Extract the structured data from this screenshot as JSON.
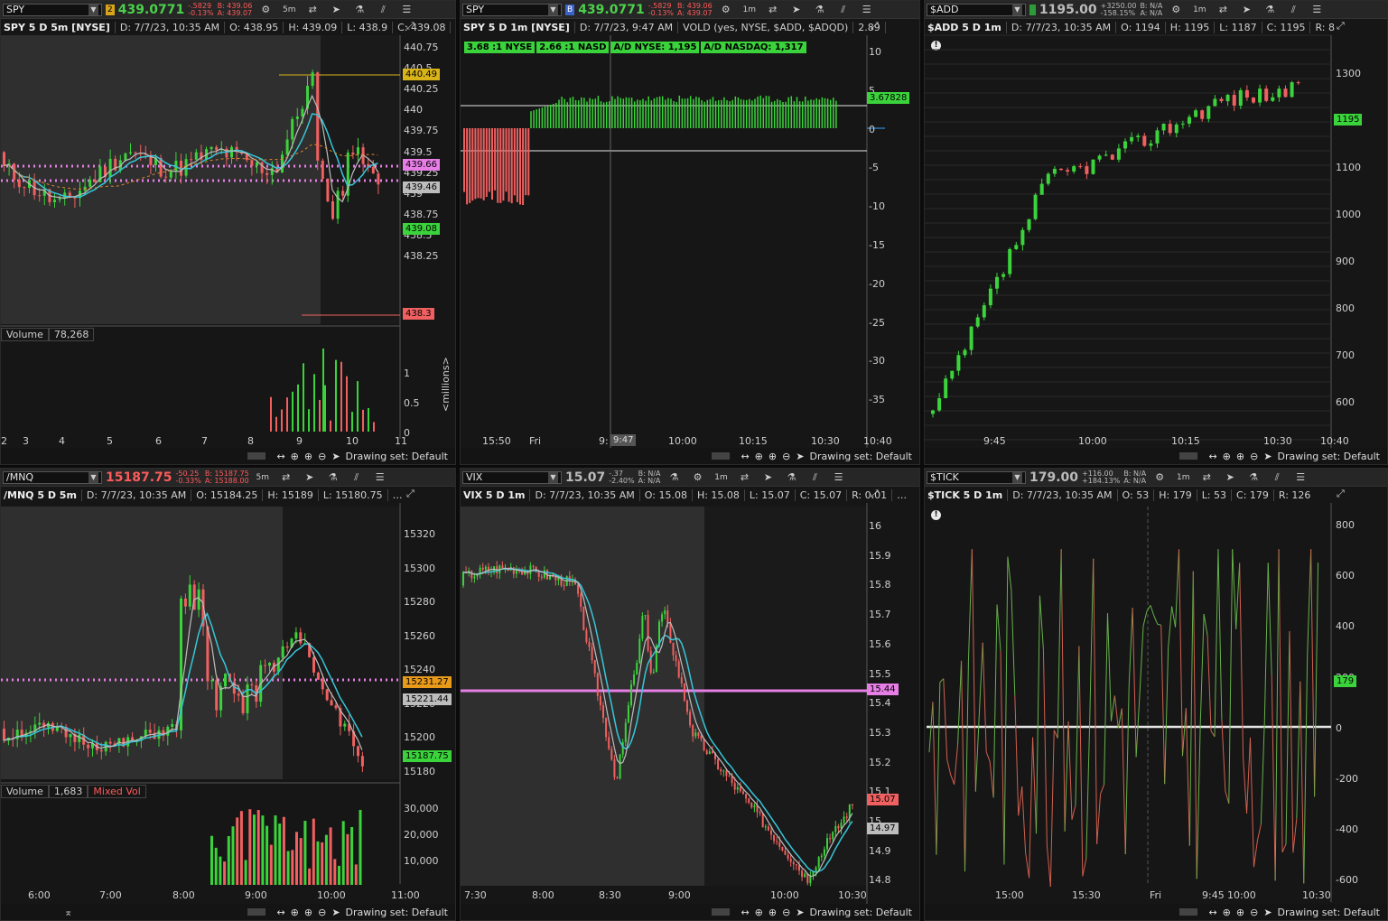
{
  "panels": {
    "spy5": {
      "symbol": "SPY",
      "badge": "2",
      "price": "439.0771",
      "chg1": "-.5829",
      "chg2": "-0.13%",
      "bid": "B: 439.06",
      "ask": "A: 439.07",
      "tf": "5m",
      "title": "SPY 5 D 5m [NYSE]",
      "date": "D: 7/7/23, 10:35 AM",
      "open": "O: 438.95",
      "high": "H: 439.09",
      "low": "L: 438.9",
      "close": "C: 439.08",
      "yticks": [
        "440.75",
        "440.5",
        "440.25",
        "440",
        "439.75",
        "439.5",
        "439.25",
        "439",
        "438.75",
        "438.5",
        "438.25"
      ],
      "labels": {
        "hi": "440.49",
        "pink": "439.66",
        "gray": "439.46",
        "last": "439.08",
        "lo": "438.3"
      },
      "vol_label": "Volume",
      "vol_val": "78,268",
      "vol_ticks": [
        "1",
        "0.5",
        "0"
      ],
      "vol_unit": "<millions>",
      "xticks": [
        "2",
        "3",
        "4",
        "5",
        "6",
        "7",
        "8",
        "9",
        "10",
        "11"
      ],
      "drawing": "Drawing set: Default"
    },
    "vold": {
      "symbol": "SPY",
      "badge": "B",
      "price": "439.0771",
      "chg1": "-.5829",
      "chg2": "-0.13%",
      "bid": "B: 439.06",
      "ask": "A: 439.07",
      "tf": "1m",
      "title": "SPY 5 D 1m [NYSE]",
      "date": "D: 7/7/23, 9:47 AM",
      "study": "VOLD (yes, NYSE, $ADD, $ADQD)",
      "study_val": "2.89",
      "chips": [
        "3.68 :1 NYSE",
        "2.66 :1 NASD",
        "A/D NYSE: 1,195",
        "A/D NASDAQ: 1,317"
      ],
      "yticks": [
        "10",
        "5",
        "0",
        "-5",
        "-10",
        "-15",
        "-20",
        "-25",
        "-30",
        "-35"
      ],
      "last": "3.67828",
      "xticks": [
        "15:50",
        "Fri",
        "9:",
        "10:00",
        "10:15",
        "10:30",
        "10:40"
      ],
      "cursor": "9:47",
      "drawing": "Drawing set: Default"
    },
    "add": {
      "symbol": "$ADD",
      "price": "1195.00",
      "chg1": "+3250.00",
      "chg2": "-158.15%",
      "bid": "B: N/A",
      "ask": "A: N/A",
      "tf": "1m",
      "title": "$ADD 5 D 1m",
      "date": "D: 7/7/23, 10:35 AM",
      "open": "O: 1194",
      "high": "H: 1195",
      "low": "L: 1187",
      "close": "C: 1195",
      "range": "R: 8",
      "yticks": [
        "1300",
        "1200",
        "1100",
        "1000",
        "900",
        "800",
        "700",
        "600"
      ],
      "last": "1195",
      "xticks": [
        "9:45",
        "10:00",
        "10:15",
        "10:30",
        "10:40"
      ],
      "drawing": "Drawing set: Default"
    },
    "mnq": {
      "symbol": "/MNQ",
      "price": "15187.75",
      "chg1": "-50.25",
      "chg2": "-0.33%",
      "bid": "B: 15187.75",
      "ask": "A: 15188.00",
      "tf": "5m",
      "title": "/MNQ 5 D 5m",
      "date": "D: 7/7/23, 10:35 AM",
      "open": "O: 15184.25",
      "high": "H: 15189",
      "low": "L: 15180.75",
      "yticks": [
        "15320",
        "15300",
        "15280",
        "15260",
        "15240",
        "15220",
        "15200",
        "15180"
      ],
      "labels": {
        "orange": "15231.27",
        "gray": "15221.44",
        "last": "15187.75"
      },
      "vol_label": "Volume",
      "vol_val": "1,683",
      "vol_mixed": "Mixed Vol",
      "vol_ticks": [
        "30,000",
        "20,000",
        "10,000"
      ],
      "xticks": [
        "6:00",
        "7:00",
        "8:00",
        "9:00",
        "10:00",
        "11:00"
      ],
      "drawing": "Drawing set: Default"
    },
    "vix": {
      "symbol": "VIX",
      "price": "15.07",
      "chg1": "-.37",
      "chg2": "-2.40%",
      "bid": "B: N/A",
      "ask": "A: N/A",
      "tf": "1m",
      "title": "VIX 5 D 1m",
      "date": "D: 7/7/23, 10:35 AM",
      "open": "O: 15.08",
      "high": "H: 15.08",
      "low": "L: 15.07",
      "close": "C: 15.07",
      "range": "R: 0.01",
      "yticks": [
        "16",
        "15.9",
        "15.8",
        "15.7",
        "15.6",
        "15.5",
        "15.4",
        "15.3",
        "15.2",
        "15.1",
        "15",
        "14.9",
        "14.8"
      ],
      "labels": {
        "pink": "15.44",
        "last": "15.07",
        "gray": "14.97"
      },
      "xticks": [
        "7:30",
        "8:00",
        "8:30",
        "9:00",
        "10:00",
        "10:30"
      ],
      "drawing": "Drawing set: Default"
    },
    "tick": {
      "symbol": "$TICK",
      "price": "179.00",
      "chg1": "+116.00",
      "chg2": "+184.13%",
      "bid": "B: N/A",
      "ask": "A: N/A",
      "tf": "1m",
      "title": "$TICK 5 D 1m",
      "date": "D: 7/7/23, 10:35 AM",
      "open": "O: 53",
      "high": "H: 179",
      "low": "L: 53",
      "close": "C: 179",
      "range": "R: 126",
      "yticks": [
        "800",
        "600",
        "400",
        "200",
        "0",
        "-200",
        "-400",
        "-600"
      ],
      "last": "179",
      "xticks": [
        "15:00",
        "15:30",
        "Fri",
        "9:45",
        "10:00",
        "10:30"
      ],
      "drawing": "Drawing set: Default"
    }
  },
  "colors": {
    "up": "#3bd33b",
    "down": "#f06060",
    "pink": "#e67ee6",
    "cyan": "#36c6d8",
    "gray": "#bdbdbd"
  }
}
